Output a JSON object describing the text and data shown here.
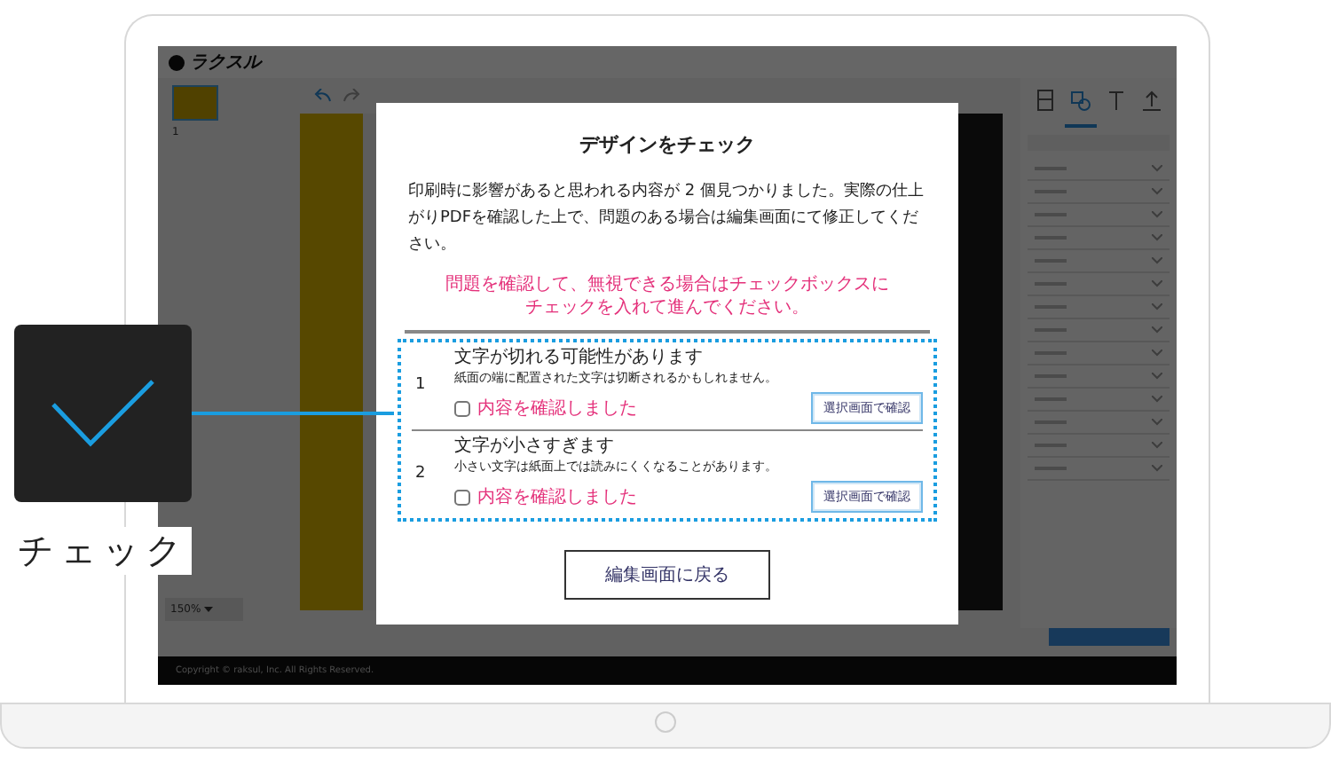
{
  "app": {
    "logo": "ラクスル",
    "page_number": "1",
    "zoom": "150%",
    "footer": "Copyright © raksul, Inc. All Rights Reserved.",
    "panel_tabs": [
      {
        "kind": "layout",
        "selected": false
      },
      {
        "kind": "material",
        "selected": true
      },
      {
        "kind": "text",
        "selected": false
      },
      {
        "kind": "upload",
        "selected": false
      }
    ]
  },
  "dialog": {
    "title": "デザインをチェック",
    "message": "印刷時に影響があると思われる内容が 2 個見つかりました。実際の仕上がりPDFを確認した上で、問題のある場合は編集画面にて修正してください。",
    "notice": "問題を確認して、無視できる場合はチェックボックスにチェックを入れて進んでください。",
    "issues": [
      {
        "number": "1",
        "title": "文字が切れる可能性があります",
        "description": "紙面の端に配置された文字は切断されるかもしれません。",
        "confirm_label": "内容を確認しました",
        "checked": false,
        "action": "選択画面で確認"
      },
      {
        "number": "2",
        "title": "文字が小さすぎます",
        "description": "小さい文字は紙面上では読みにくくなることがあります。",
        "confirm_label": "内容を確認しました",
        "checked": false,
        "action": "選択画面で確認"
      }
    ],
    "back_button": "編集画面に戻る"
  },
  "callout": {
    "label": "チェック"
  }
}
